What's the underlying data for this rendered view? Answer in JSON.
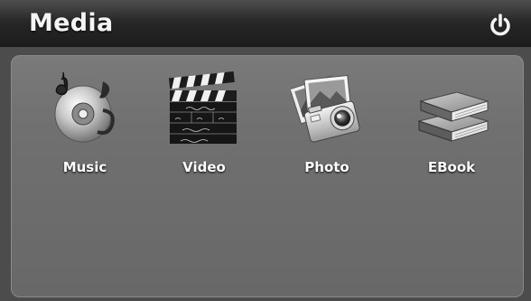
{
  "header": {
    "title": "Media",
    "power_icon": "power-icon"
  },
  "menu": {
    "items": [
      {
        "label": "Music",
        "icon": "music-disc-icon"
      },
      {
        "label": "Video",
        "icon": "clapperboard-icon"
      },
      {
        "label": "Photo",
        "icon": "camera-photos-icon"
      },
      {
        "label": "EBook",
        "icon": "books-icon"
      }
    ]
  }
}
